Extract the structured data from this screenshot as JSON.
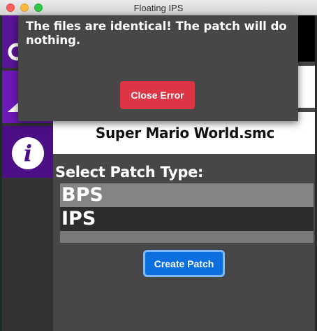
{
  "window": {
    "title": "Floating IPS"
  },
  "sidebar": {
    "items": [
      {
        "icon": "user-icon"
      },
      {
        "icon": "home-icon"
      },
      {
        "icon": "info-icon",
        "glyph": "i"
      }
    ]
  },
  "main": {
    "selected_file": "Super Mario World.smc",
    "patch_type_label": "Select Patch Type:",
    "patch_options": [
      "BPS",
      "IPS"
    ],
    "selected_option": "IPS",
    "create_button_label": "Create Patch"
  },
  "error_modal": {
    "message": "The files are identical! The patch will do nothing.",
    "close_label": "Close Error"
  },
  "colors": {
    "sidebar_accent": "#4b0e84",
    "primary_button": "#0b6fe0",
    "danger_button": "#dc3545"
  }
}
